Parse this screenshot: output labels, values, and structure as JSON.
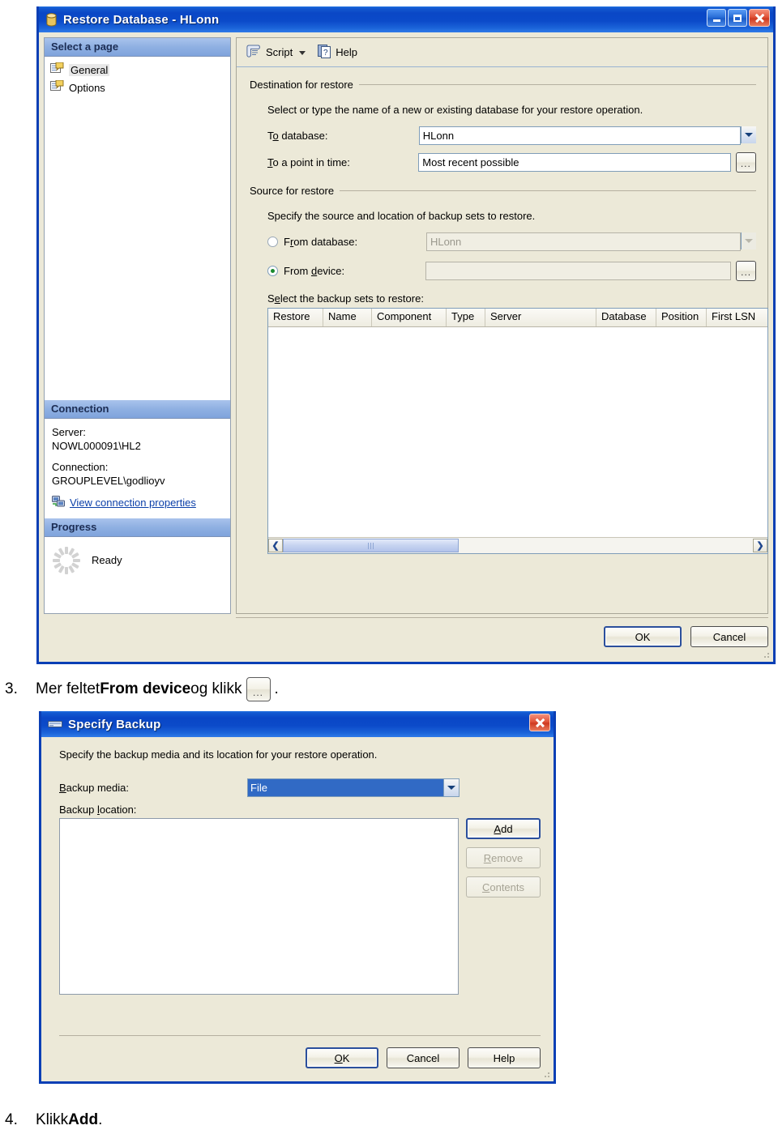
{
  "restore_dialog": {
    "title": "Restore Database - HLonn",
    "title_icon": "database-icon",
    "caption": {
      "minimize": "Minimize",
      "maximize": "Maximize",
      "close": "Close"
    },
    "sidebar": {
      "select_page_header": "Select a page",
      "pages": [
        {
          "label": "General",
          "icon": "page-icon",
          "selected": true
        },
        {
          "label": "Options",
          "icon": "page-icon",
          "selected": false
        }
      ],
      "connection_header": "Connection",
      "server_label": "Server:",
      "server_value": "NOWL000091\\HL2",
      "connection_label": "Connection:",
      "connection_value": "GROUPLEVEL\\godlioyv",
      "view_connection_link": "View connection properties",
      "view_connection_icon": "server-connection-icon",
      "progress_header": "Progress",
      "progress_status": "Ready",
      "progress_icon": "spinner-icon"
    },
    "toolbar": {
      "script_label": "Script",
      "script_icon": "script-icon",
      "script_caret": "chevron-down-icon",
      "help_label": "Help",
      "help_icon": "help-icon"
    },
    "destination": {
      "group_title": "Destination for restore",
      "hint": "Select or type the name of a new or existing database for your restore operation.",
      "to_database_label": "To database:",
      "to_database_value": "HLonn",
      "to_point_label": "To a point in time:",
      "to_point_value": "Most recent possible",
      "browse_label": "..."
    },
    "source": {
      "group_title": "Source for restore",
      "hint": "Specify the source and location of backup sets to restore.",
      "from_database_label": "From database:",
      "from_database_value": "HLonn",
      "from_database_selected": false,
      "from_device_label": "From device:",
      "from_device_value": "",
      "from_device_selected": true,
      "browse_label": "...",
      "grid_label": "Select the backup sets to restore:",
      "grid_columns": [
        "Restore",
        "Name",
        "Component",
        "Type",
        "Server",
        "Database",
        "Position",
        "First LSN"
      ],
      "grid_rows": [],
      "scroll_left_icon": "chevron-left-icon",
      "scroll_right_icon": "chevron-right-icon"
    },
    "buttons": {
      "ok": "OK",
      "cancel": "Cancel"
    }
  },
  "step3": {
    "number": "3.",
    "text_before": "Mer feltet ",
    "bold": "From device",
    "text_after": " og klikk ",
    "button_glyph": "...",
    "text_end": "."
  },
  "specify_dialog": {
    "title": "Specify Backup",
    "title_icon": "backup-media-icon",
    "caption": {
      "close": "Close"
    },
    "description": "Specify the backup media and its location for your restore operation.",
    "backup_media_label": "Backup media:",
    "backup_media_value": "File",
    "backup_location_label": "Backup location:",
    "backup_location_items": [],
    "side_buttons": [
      {
        "label": "Add",
        "enabled": true,
        "default": true
      },
      {
        "label": "Remove",
        "enabled": false,
        "default": false
      },
      {
        "label": "Contents",
        "enabled": false,
        "default": false
      }
    ],
    "footer_buttons": [
      {
        "label": "OK",
        "default": true
      },
      {
        "label": "Cancel",
        "default": false
      },
      {
        "label": "Help",
        "default": false
      }
    ]
  },
  "step4": {
    "number": "4.",
    "text_before": "Klikk ",
    "bold": "Add",
    "text_after": "."
  }
}
